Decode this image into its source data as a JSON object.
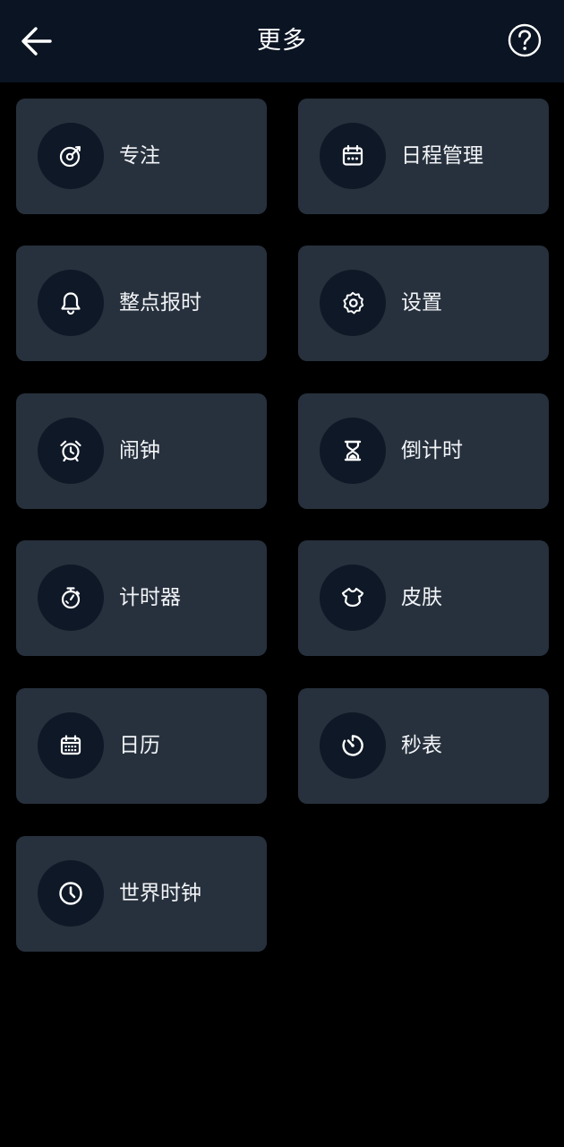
{
  "header": {
    "title": "更多",
    "back_icon": "arrow-left-icon",
    "help_icon": "question-circle-icon"
  },
  "colors": {
    "background": "#000000",
    "header_bg": "#0b1422",
    "tile_bg": "#27313d",
    "icon_circle_bg": "#0e1826",
    "text": "#ffffff"
  },
  "tiles": [
    {
      "label": "专注",
      "icon": "focus-target-icon"
    },
    {
      "label": "日程管理",
      "icon": "schedule-calendar-icon"
    },
    {
      "label": "整点报时",
      "icon": "bell-icon"
    },
    {
      "label": "设置",
      "icon": "gear-icon"
    },
    {
      "label": "闹钟",
      "icon": "alarm-clock-icon"
    },
    {
      "label": "倒计时",
      "icon": "hourglass-icon"
    },
    {
      "label": "计时器",
      "icon": "stopwatch-icon"
    },
    {
      "label": "皮肤",
      "icon": "shirt-icon"
    },
    {
      "label": "日历",
      "icon": "calendar-icon"
    },
    {
      "label": "秒表",
      "icon": "timer-dial-icon"
    },
    {
      "label": "世界时钟",
      "icon": "clock-icon"
    }
  ]
}
